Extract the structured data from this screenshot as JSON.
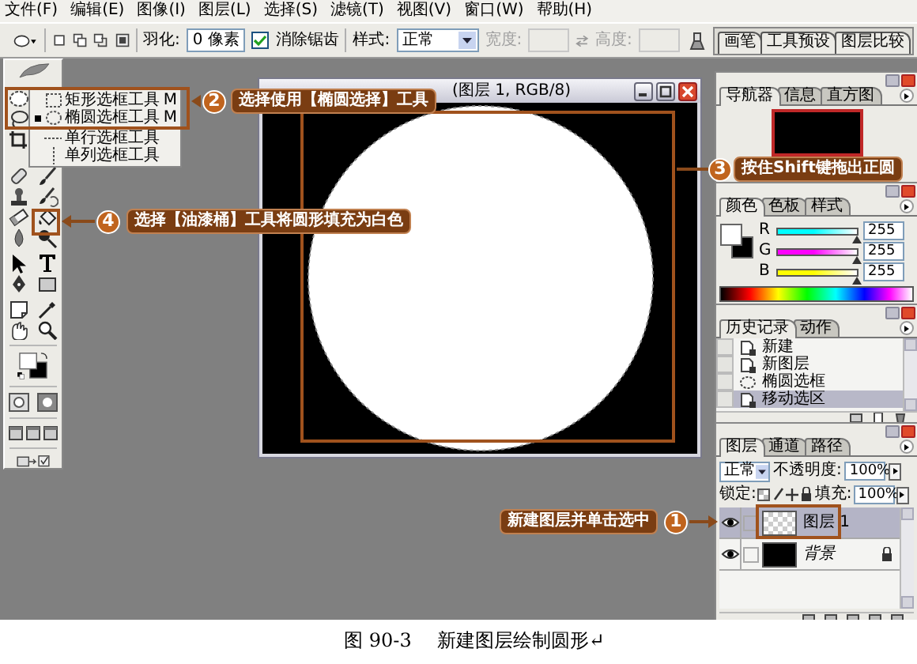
{
  "menu_bar": [
    "文件(F)",
    "编辑(E)",
    "图像(I)",
    "图层(L)",
    "选择(S)",
    "滤镜(T)",
    "视图(V)",
    "窗口(W)",
    "帮助(H)"
  ],
  "options_bar": {
    "feather_label": "羽化:",
    "feather_value": "0 像素",
    "anti_alias": {
      "label": "消除锯齿",
      "checked": true
    },
    "style_label": "样式:",
    "style_value": "正常",
    "width_label": "宽度:",
    "height_label": "高度:",
    "size_disabled": true,
    "palette_tabs": [
      "画笔",
      "工具预设",
      "图层比较"
    ]
  },
  "tool_flyout": [
    {
      "label": "矩形选框工具",
      "shortcut": "M",
      "kind": "rect",
      "selected": false
    },
    {
      "label": "椭圆选框工具",
      "shortcut": "M",
      "kind": "ellipse",
      "selected": true
    },
    {
      "label": "单行选框工具",
      "kind": "row",
      "selected": false
    },
    {
      "label": "单列选框工具",
      "kind": "column",
      "selected": false
    }
  ],
  "document": {
    "title": "(图层 1, RGB/8)"
  },
  "navigator": {
    "tabs": [
      {
        "label": "导航器",
        "selected": true
      },
      {
        "label": "信息",
        "selected": false
      },
      {
        "label": "直方图",
        "selected": false
      }
    ]
  },
  "color_panel": {
    "tabs": [
      {
        "label": "颜色",
        "selected": true
      },
      {
        "label": "色板",
        "selected": false
      },
      {
        "label": "样式",
        "selected": false
      }
    ],
    "channels": [
      {
        "name": "R",
        "color": "#00ffff",
        "level": 1,
        "value": "255"
      },
      {
        "name": "G",
        "color": "#ff00ff",
        "level": 1,
        "value": "255"
      },
      {
        "name": "B",
        "color": "#ffff00",
        "level": 1,
        "value": "255"
      }
    ]
  },
  "history": {
    "tabs": [
      {
        "label": "历史记录",
        "selected": true
      },
      {
        "label": "动作",
        "selected": false
      }
    ],
    "items": [
      {
        "label": "新建",
        "kind": "document",
        "selected": false
      },
      {
        "label": "新图层",
        "kind": "document",
        "selected": false
      },
      {
        "label": "椭圆选框",
        "kind": "ellipse",
        "selected": false
      },
      {
        "label": "移动选区",
        "kind": "document",
        "selected": true
      }
    ]
  },
  "layers": {
    "tabs": [
      {
        "label": "图层",
        "selected": true
      },
      {
        "label": "通道",
        "selected": false
      },
      {
        "label": "路径",
        "selected": false
      }
    ],
    "blend_mode": "正常",
    "opacity_label": "不透明度:",
    "opacity": "100%",
    "lock_label": "锁定:",
    "fill_label": "填充:",
    "fill": "100%",
    "items": [
      {
        "name": "图层 1",
        "kind": "transparent",
        "selected": true,
        "visible": true,
        "locked": false
      },
      {
        "name": "背景",
        "kind": "background",
        "selected": false,
        "visible": true,
        "locked": true
      }
    ]
  },
  "callouts": [
    {
      "number": "2",
      "text": "选择使用【椭圆选择】工具"
    },
    {
      "number": "3",
      "text": "按住Shift键拖出正圆"
    },
    {
      "number": "4",
      "text": "选择【油漆桶】工具将圆形填充为白色"
    },
    {
      "number": "1",
      "text": "新建图层并单击选中"
    }
  ],
  "caption": {
    "figure": "图 90-3",
    "title": "新建图层绘制圆形↵"
  }
}
